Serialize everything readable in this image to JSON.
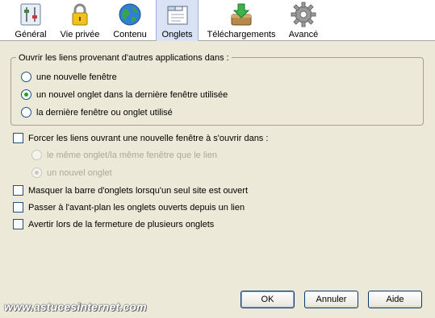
{
  "toolbar": {
    "items": [
      {
        "label": "Général",
        "icon": "general-icon"
      },
      {
        "label": "Vie privée",
        "icon": "padlock-icon"
      },
      {
        "label": "Contenu",
        "icon": "globe-icon"
      },
      {
        "label": "Onglets",
        "icon": "tabs-icon",
        "selected": true
      },
      {
        "label": "Téléchargements",
        "icon": "download-icon"
      },
      {
        "label": "Avancé",
        "icon": "gear-icon"
      }
    ]
  },
  "links_group": {
    "legend": "Ouvrir les liens provenant d'autres applications dans :",
    "options": [
      {
        "label": "une nouvelle fenêtre",
        "selected": false
      },
      {
        "label": "un nouvel onglet dans la dernière fenêtre utilisée",
        "selected": true
      },
      {
        "label": "la dernière fenêtre ou onglet utilisé",
        "selected": false
      }
    ]
  },
  "force_new_window": {
    "label": "Forcer les liens ouvrant une nouvelle fenêtre à s'ouvrir dans :",
    "checked": false,
    "options": [
      {
        "label": "le même onglet/la même fenêtre que le lien",
        "selected": false,
        "disabled": true
      },
      {
        "label": "un nouvel onglet",
        "selected": true,
        "disabled": true
      }
    ]
  },
  "checkboxes": [
    {
      "label": "Masquer la barre d'onglets lorsqu'un seul site est ouvert",
      "checked": false
    },
    {
      "label": "Passer à l'avant-plan les onglets ouverts depuis un lien",
      "checked": false
    },
    {
      "label": "Avertir lors de la fermeture de plusieurs onglets",
      "checked": false
    }
  ],
  "buttons": {
    "ok": "OK",
    "cancel": "Annuler",
    "help": "Aide"
  },
  "watermark": "www.astucesinternet.com",
  "colors": {
    "dialog_bg": "#ece9d8",
    "selected_tab_bg": "#d9e3f5",
    "radio_dot": "#21a121"
  }
}
